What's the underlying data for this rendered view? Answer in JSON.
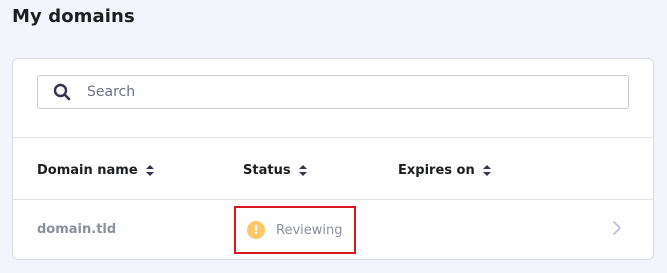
{
  "page": {
    "title": "My domains"
  },
  "search": {
    "placeholder": "Search",
    "value": ""
  },
  "table": {
    "columns": [
      {
        "label": "Domain name",
        "icon": "sort-icon"
      },
      {
        "label": "Status",
        "icon": "sort-icon"
      },
      {
        "label": "Expires on",
        "icon": "sort-icon"
      }
    ],
    "rows": [
      {
        "domain": "domain.tld",
        "status": "Reviewing",
        "status_icon": "warning-icon",
        "expires": ""
      }
    ]
  },
  "colors": {
    "background": "#f4f5fc",
    "warning": "#ffc866",
    "highlight_border": "#d9171f"
  }
}
